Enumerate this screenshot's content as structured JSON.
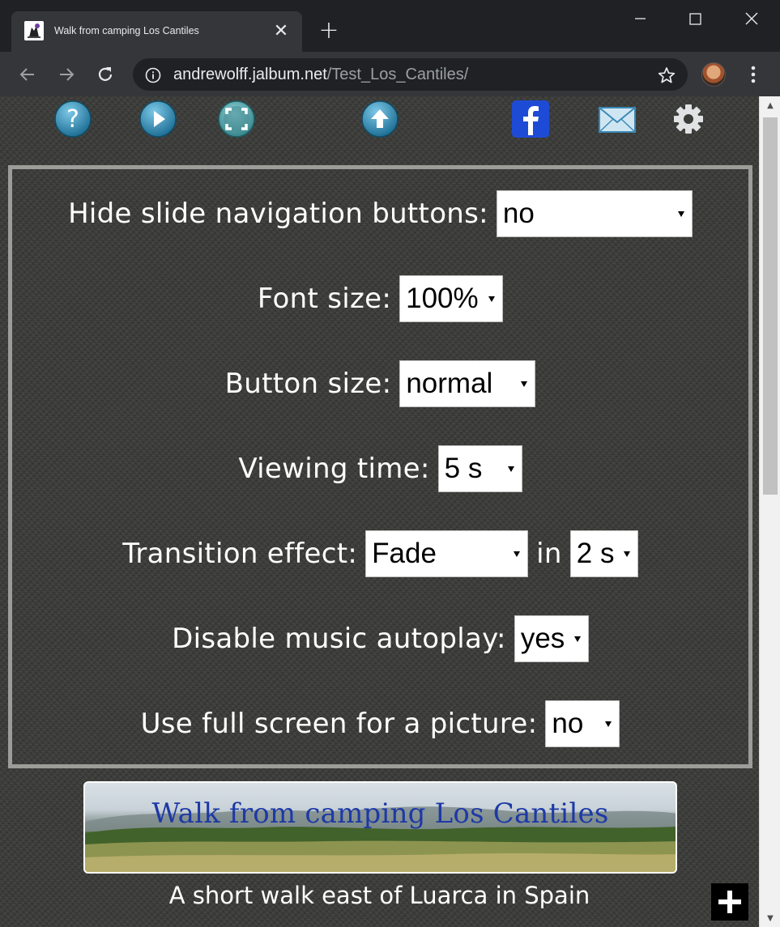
{
  "browser": {
    "tab_title": "Walk from camping Los Cantiles",
    "url_host": "andrewolff.jalbum.net",
    "url_path": "/Test_Los_Cantiles/"
  },
  "icons": [
    "help-icon",
    "play-icon",
    "fullscreen-icon",
    "up-arrow-icon",
    "facebook-icon",
    "mail-icon",
    "gear-icon"
  ],
  "settings": {
    "hide_nav": {
      "label": "Hide slide navigation buttons:",
      "value": "no"
    },
    "font_size": {
      "label": "Font size:",
      "value": "100%"
    },
    "button_size": {
      "label": "Button size:",
      "value": "normal"
    },
    "viewing_time": {
      "label": "Viewing time:",
      "value": "5 s"
    },
    "transition": {
      "label": "Transition effect:",
      "value": "Fade",
      "in_word": "in",
      "duration": "2 s"
    },
    "music": {
      "label": "Disable music autoplay:",
      "value": "yes"
    },
    "fullscreen": {
      "label": "Use full screen for a picture:",
      "value": "no"
    }
  },
  "album": {
    "title": "Walk from camping Los Cantiles",
    "subtitle": "A short walk east of Luarca in Spain"
  },
  "colors": {
    "panel_border": "#9c9d98",
    "banner_title": "#1d39a6",
    "page_bg": "#3b3c39"
  }
}
